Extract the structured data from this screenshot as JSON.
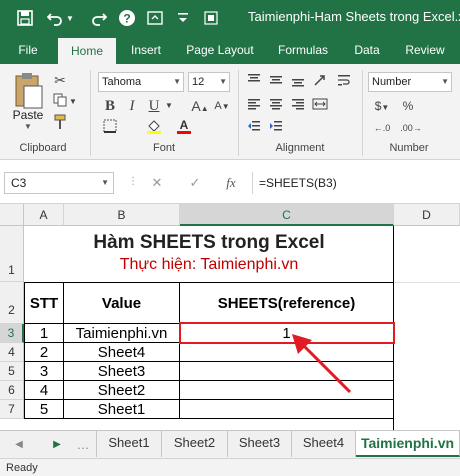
{
  "window": {
    "title": "Taimienphi-Ham Sheets trong Excel.xls",
    "qat_icons": [
      "save-icon",
      "undo-icon",
      "undo-dropdown-icon",
      "help-icon",
      "collapse-ribbon-icon",
      "minimize-icon"
    ]
  },
  "tabs": [
    {
      "label": "File"
    },
    {
      "label": "Home"
    },
    {
      "label": "Insert"
    },
    {
      "label": "Page Layout"
    },
    {
      "label": "Formulas"
    },
    {
      "label": "Data"
    },
    {
      "label": "Review"
    }
  ],
  "ribbon": {
    "clipboard": {
      "label": "Clipboard",
      "paste_label": "Paste"
    },
    "font": {
      "label": "Font",
      "font_name": "Tahoma",
      "font_size": "12"
    },
    "alignment": {
      "label": "Alignment"
    },
    "number": {
      "label": "Number",
      "format": "Number"
    }
  },
  "formula_bar": {
    "name_box": "C3",
    "cancel": "✕",
    "enter": "✓",
    "fx": "fx",
    "formula": "=SHEETS(B3)"
  },
  "columns": [
    "A",
    "B",
    "C",
    "D"
  ],
  "rows": [
    "1",
    "2",
    "3",
    "4",
    "5",
    "6",
    "7"
  ],
  "sheet": {
    "title": "Hàm SHEETS trong Excel",
    "subtitle": "Thực hiện: Taimienphi.vn",
    "headers": {
      "stt": "STT",
      "value": "Value",
      "result": "SHEETS(reference)"
    },
    "data_rows": [
      {
        "stt": "1",
        "value": "Taimienphi.vn",
        "result": "1"
      },
      {
        "stt": "2",
        "value": "Sheet4",
        "result": ""
      },
      {
        "stt": "3",
        "value": "Sheet3",
        "result": ""
      },
      {
        "stt": "4",
        "value": "Sheet2",
        "result": ""
      },
      {
        "stt": "5",
        "value": "Sheet1",
        "result": ""
      }
    ]
  },
  "sheet_tabs": [
    {
      "label": "Sheet1"
    },
    {
      "label": "Sheet2"
    },
    {
      "label": "Sheet3"
    },
    {
      "label": "Sheet4"
    },
    {
      "label": "Taimienphi.vn"
    }
  ],
  "status": "Ready",
  "colors": {
    "excel_green": "#217346",
    "highlight_red": "#e01b24",
    "subtitle_red": "#c00000"
  }
}
